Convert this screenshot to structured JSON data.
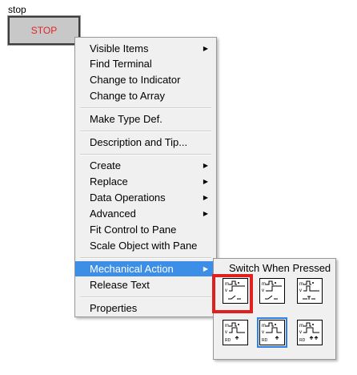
{
  "stop_control": {
    "label": "stop",
    "button_text": "STOP"
  },
  "menu": {
    "items": [
      {
        "label": "Visible Items",
        "submenu": true
      },
      {
        "label": "Find Terminal",
        "submenu": false
      },
      {
        "label": "Change to Indicator",
        "submenu": false
      },
      {
        "label": "Change to Array",
        "submenu": false
      },
      {
        "label": "Make Type Def.",
        "submenu": false
      },
      {
        "label": "Description and Tip...",
        "submenu": false
      },
      {
        "label": "Create",
        "submenu": true
      },
      {
        "label": "Replace",
        "submenu": true
      },
      {
        "label": "Data Operations",
        "submenu": true
      },
      {
        "label": "Advanced",
        "submenu": true
      },
      {
        "label": "Fit Control to Pane",
        "submenu": false
      },
      {
        "label": "Scale Object with Pane",
        "submenu": false
      },
      {
        "label": "Mechanical Action",
        "submenu": true,
        "active": true
      },
      {
        "label": "Release Text",
        "submenu": false
      },
      {
        "label": "Properties",
        "submenu": false
      }
    ],
    "arrow_glyph": "▶"
  },
  "mechanical_action": {
    "hovered_label": "Switch When Pressed",
    "options": [
      {
        "icon": "switch-when-pressed-icon",
        "highlighted": true
      },
      {
        "icon": "switch-when-released-icon"
      },
      {
        "icon": "switch-until-released-icon"
      },
      {
        "icon": "latch-when-pressed-icon"
      },
      {
        "icon": "latch-when-released-icon",
        "selected": true
      },
      {
        "icon": "latch-until-released-icon"
      }
    ]
  },
  "colors": {
    "accent": "#3d8ee7",
    "highlight_box": "#e0201f",
    "stop_text": "#e0242a"
  }
}
